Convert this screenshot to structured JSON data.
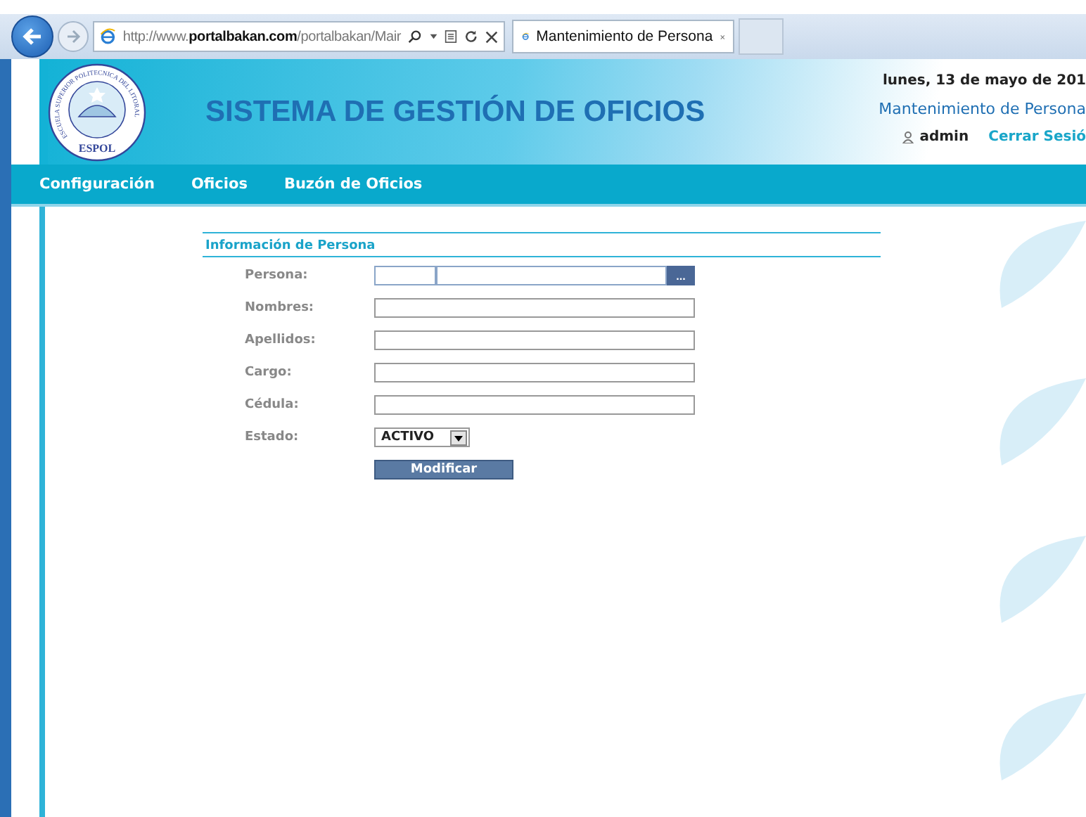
{
  "browser": {
    "address": "http://www.**portalbakan.com**/portalbakan/Mair",
    "tab": {
      "title": "Mantenimiento de Persona",
      "selected": true
    }
  },
  "header": {
    "logo_ring": "ESCUELA SUPERIOR POLITECNICA DEL LITORAL",
    "logo_text": "ESPOL",
    "title": "SISTEMA DE GESTIÓN DE OFICIOS",
    "date": "lunes, 13 de mayo de 201",
    "page": "Mantenimiento de Persona",
    "user": "admin",
    "logout": "Cerrar Sesió"
  },
  "nav": [
    "Configuración",
    "Oficios",
    "Buzón de Oficios"
  ],
  "form": {
    "title": "Información de Persona",
    "fields": [
      {
        "kind": "lookup",
        "label": "Persona:",
        "button": "..."
      },
      {
        "kind": "text",
        "label": "Nombres:"
      },
      {
        "kind": "text",
        "label": "Apellidos:"
      },
      {
        "kind": "text",
        "label": "Cargo:"
      },
      {
        "kind": "text",
        "label": "Cédula:"
      },
      {
        "kind": "select",
        "label": "Estado:",
        "value": "ACTIVO"
      }
    ],
    "submit": "Modificar"
  }
}
